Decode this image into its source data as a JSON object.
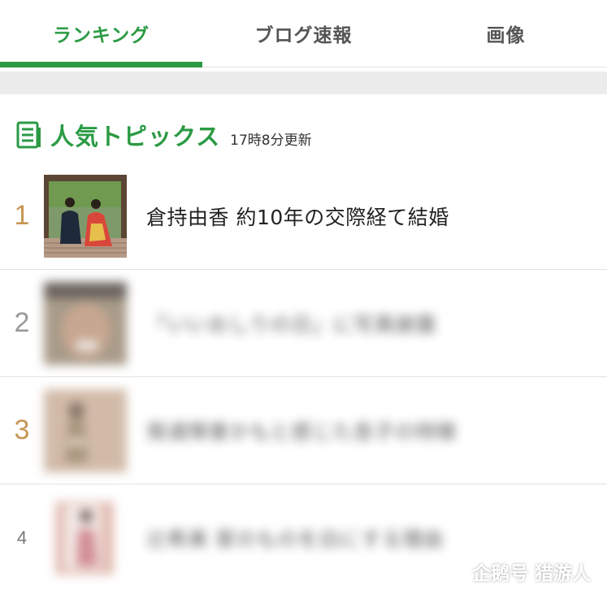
{
  "tabs": [
    {
      "label": "ランキング",
      "active": true
    },
    {
      "label": "ブログ速報",
      "active": false
    },
    {
      "label": "画像",
      "active": false
    }
  ],
  "section": {
    "title": "人気トピックス",
    "updated": "17時8分更新",
    "icon": "document-list-icon"
  },
  "items": [
    {
      "rank": "1",
      "title": "倉持由香 約10年の交際経て結婚"
    },
    {
      "rank": "2",
      "title": "「いいおしりの日」に写真披露"
    },
    {
      "rank": "3",
      "title": "発達障害かもと感じた息子の特徴"
    },
    {
      "rank": "4",
      "title": "辻希美 家のものを白にする理由"
    }
  ],
  "watermark": {
    "text": "企鹅号 猎游人",
    "icon": "penguin-icon"
  },
  "colors": {
    "accent": "#2b9a44",
    "rank_gold": "#c79653",
    "rank_gray": "#9a9a9a"
  }
}
